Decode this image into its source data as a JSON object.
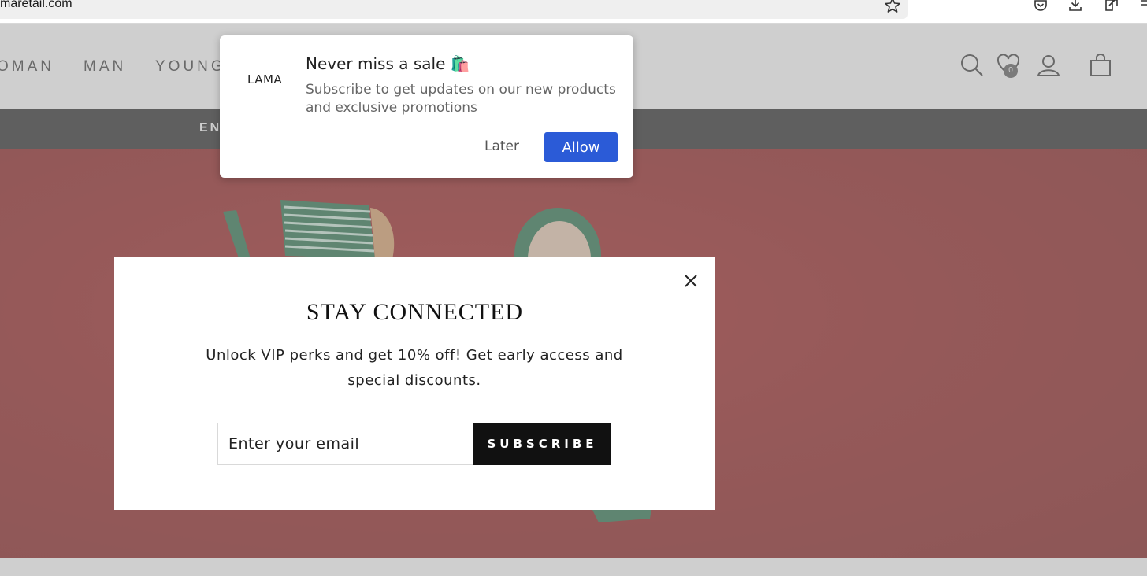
{
  "browser": {
    "url": "maretail.com"
  },
  "header": {
    "nav": [
      "OMAN",
      "MAN",
      "YOUNG"
    ],
    "wishlist_count": "0"
  },
  "announcement": {
    "text": "EN"
  },
  "push_prompt": {
    "logo": "LAMA",
    "title": "Never miss a sale 🛍️",
    "body": "Subscribe to get updates on our new products and exclusive promotions",
    "later_label": "Later",
    "allow_label": "Allow"
  },
  "modal": {
    "title": "STAY CONNECTED",
    "description": "Unlock VIP perks and get 10% off! Get early access and special discounts.",
    "email_placeholder": "Enter your email",
    "subscribe_label": "SUBSCRIBE"
  },
  "colors": {
    "allow_button": "#2b5bd7",
    "subscribe_button": "#111111",
    "hero_background": "#8a1212"
  }
}
